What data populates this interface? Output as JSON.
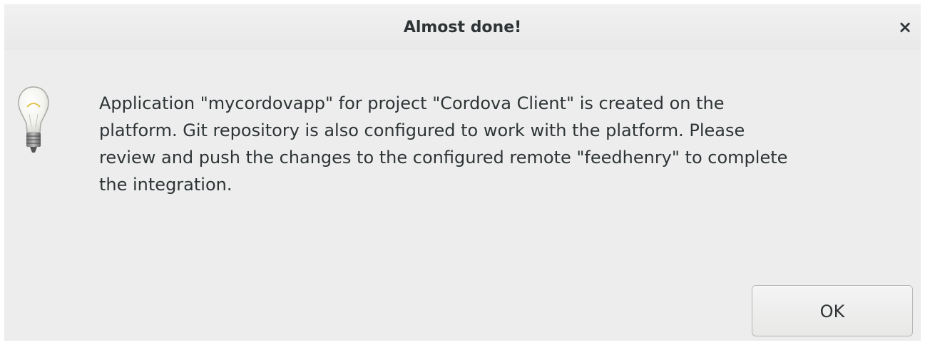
{
  "window": {
    "title": "Almost done!",
    "close_glyph": "×",
    "close_icon": "close-icon"
  },
  "body": {
    "icon": "lightbulb-icon",
    "message": "Application \"mycordovapp\" for project \"Cordova Client\" is created on the\nplatform. Git repository is also configured to work with the platform. Please\nreview and push the changes to the configured remote \"feedhenry\" to complete\nthe integration."
  },
  "buttons": {
    "ok_label": "OK"
  }
}
